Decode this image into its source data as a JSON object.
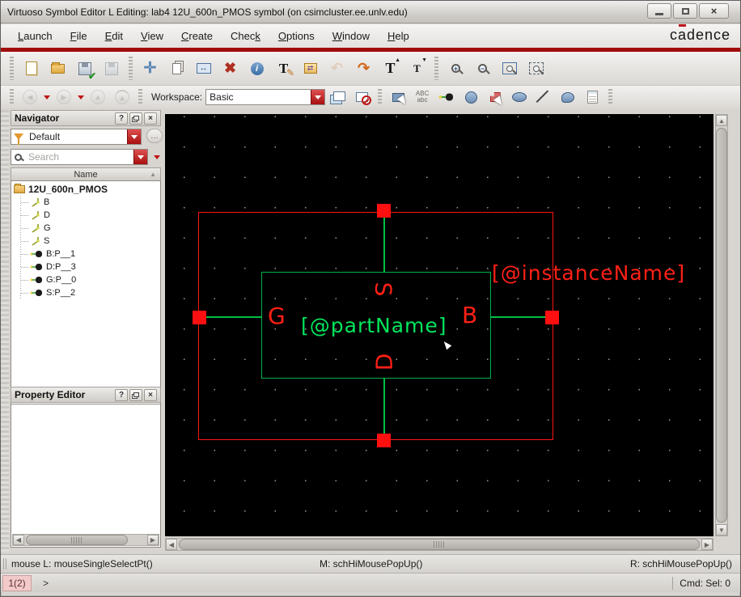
{
  "window": {
    "title": "Virtuoso Symbol Editor L Editing: lab4 12U_600n_PMOS symbol (on csimcluster.ee.unlv.edu)"
  },
  "menu": {
    "items": [
      {
        "pre": "",
        "u": "L",
        "post": "aunch"
      },
      {
        "pre": "",
        "u": "F",
        "post": "ile"
      },
      {
        "pre": "",
        "u": "E",
        "post": "dit"
      },
      {
        "pre": "",
        "u": "V",
        "post": "iew"
      },
      {
        "pre": "",
        "u": "C",
        "post": "reate"
      },
      {
        "pre": "Chec",
        "u": "k",
        "post": ""
      },
      {
        "pre": "",
        "u": "O",
        "post": "ptions"
      },
      {
        "pre": "",
        "u": "W",
        "post": "indow"
      },
      {
        "pre": "",
        "u": "H",
        "post": "elp"
      }
    ],
    "logo": {
      "pre": "c",
      "a": "a",
      "post": "dence"
    }
  },
  "icons": {
    "check": "✔",
    "delete": "✖",
    "info": "i",
    "text": "T",
    "pencil": "✎",
    "prop_arrow": "⇄",
    "undo": "↶",
    "redo": "↷",
    "caret_up": "▲",
    "caret_down": "▼",
    "move": "✛",
    "stretch_arrows": "↔",
    "nav_back": "◀",
    "nav_forward": "▶",
    "nav_up": "▲",
    "nav_top": "▲",
    "zoom_plus": "+",
    "zoom_minus": "−",
    "help": "?",
    "close": "×",
    "more": "…",
    "sort_asc": "▲",
    "abc_upper": "ABC",
    "abc_lower": "abc",
    "minimize": "",
    "maximize": "",
    "window_close": "×",
    "sb_up": "▲",
    "sb_down": "▼",
    "sb_left": "◀",
    "sb_right": "▶"
  },
  "workspace": {
    "label": "Workspace:",
    "value": "Basic"
  },
  "navigator": {
    "title": "Navigator",
    "filter_value": "Default",
    "search_placeholder": "Search",
    "column_header": "Name",
    "tree": {
      "root": "12U_600n_PMOS",
      "wires": [
        "B",
        "D",
        "G",
        "S"
      ],
      "pins": [
        "B:P__1",
        "D:P__3",
        "G:P__0",
        "S:P__2"
      ]
    }
  },
  "property_editor": {
    "title": "Property Editor"
  },
  "symbol": {
    "pin_top": "S",
    "pin_bottom": "D",
    "pin_left": "G",
    "pin_right": "B",
    "part_name": "[@partName]",
    "instance_name": "[@instanceName]",
    "colors": {
      "outline": "#ff1414",
      "shape": "#00b347",
      "part_name_text": "#00e65c",
      "label_text": "#ff2015",
      "canvas_bg": "#000000"
    }
  },
  "status": {
    "left": "mouse L: mouseSingleSelectPt()",
    "middle": "M: schHiMousePopUp()",
    "right": "R: schHiMousePopUp()"
  },
  "command": {
    "badge": "1(2)",
    "prompt": ">",
    "right": "Cmd: Sel: 0"
  }
}
